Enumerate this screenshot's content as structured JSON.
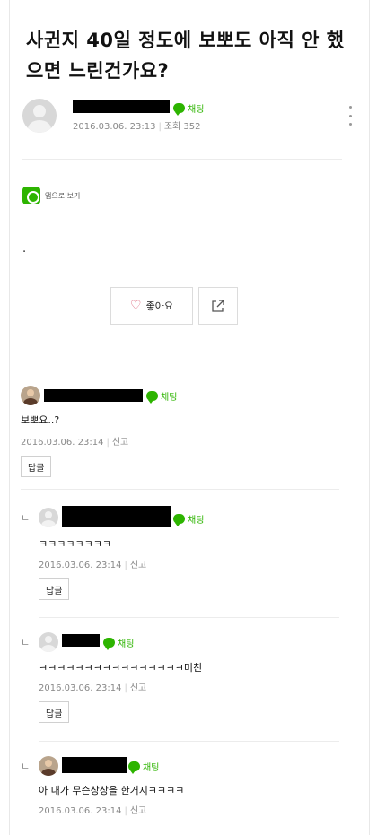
{
  "post": {
    "title": "사귄지 40일 정도에 보뽀도 아직 안 했으면 느린건가요?",
    "chat_label": "채팅",
    "date": "2016.03.06. 23:13",
    "views": "조회 352",
    "app_view_label": "앱으로 보기",
    "body": ".",
    "like_label": "좋아요"
  },
  "comments": [
    {
      "text": "보뽀요..?",
      "date": "2016.03.06. 23:14",
      "report": "신고",
      "reply_label": "답글",
      "chat_label": "채팅"
    },
    {
      "text": "ㅋㅋㅋㅋㅋㅋㅋㅋ",
      "date": "2016.03.06. 23:14",
      "report": "신고",
      "reply_label": "답글",
      "chat_label": "채팅",
      "reply_mark": "ㄴ"
    },
    {
      "text": "ㅋㅋㅋㅋㅋㅋㅋㅋㅋㅋㅋㅋㅋㅋㅋㅋ미친",
      "date": "2016.03.06. 23:14",
      "report": "신고",
      "reply_label": "답글",
      "chat_label": "채팅",
      "reply_mark": "ㄴ"
    },
    {
      "text": "아 내가 무슨상상을 한거지ㅋㅋㅋㅋ",
      "date": "2016.03.06. 23:14",
      "report": "신고",
      "chat_label": "채팅",
      "reply_mark": "ㄴ"
    }
  ],
  "colors": {
    "chat_green": "#2db400",
    "heart_red": "#d9546b",
    "meta_gray": "#888888"
  }
}
